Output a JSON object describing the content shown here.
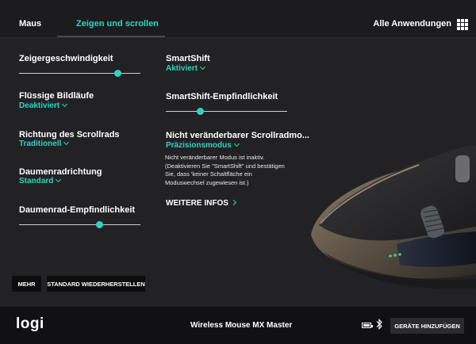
{
  "tabs": [
    {
      "label": "Maus",
      "active": false
    },
    {
      "label": "Zeigen und scrollen",
      "active": true
    }
  ],
  "header": {
    "all_apps_label": "Alle Anwendungen",
    "all_apps_icon": "grid-icon"
  },
  "left_column": {
    "pointer_speed": {
      "label": "Zeigergeschwindigkeit",
      "value_fraction": 0.81
    },
    "smooth_scrolling": {
      "label": "Flüssige Bildläufe",
      "value": "Deaktiviert"
    },
    "scroll_direction": {
      "label": "Richtung des Scrollrads",
      "value": "Traditionell"
    },
    "thumbwheel_direction": {
      "label": "Daumenradrichtung",
      "value": "Standard"
    },
    "thumbwheel_sensitivity": {
      "label": "Daumenrad-Empfindlichkeit",
      "value_fraction": 0.66
    }
  },
  "right_column": {
    "smartshift": {
      "label": "SmartShift",
      "value": "Aktiviert"
    },
    "smartshift_sensitivity": {
      "label": "SmartShift-Empfindlichkeit",
      "value_fraction": 0.28
    },
    "fixed_scroll_mode": {
      "label": "Nicht veränderbarer Scrollradmo...",
      "value": "Präzisionsmodus",
      "note_lines": [
        "Nicht veränderbarer Modus ist inaktiv.",
        "(Deaktivieren Sie \"SmartShift\" und bestätigen",
        "Sie, dass 'keiner Schaltfläche ein",
        "Moduswechsel zugewiesen ist.)"
      ]
    },
    "more_info_label": "WEITERE INFOS"
  },
  "buttons": {
    "more_label": "MEHR",
    "reset_label": "STANDARD WIEDERHERSTELLEN"
  },
  "footer": {
    "logo_text": "logi",
    "device_name": "Wireless Mouse MX Master",
    "add_devices_label": "GERÄTE HINZUFÜGEN",
    "battery_icon": "battery-icon",
    "bluetooth_icon": "bluetooth-icon"
  },
  "colors": {
    "accent": "#2fd3c1",
    "background": "#222224",
    "footer_background": "#111113"
  }
}
